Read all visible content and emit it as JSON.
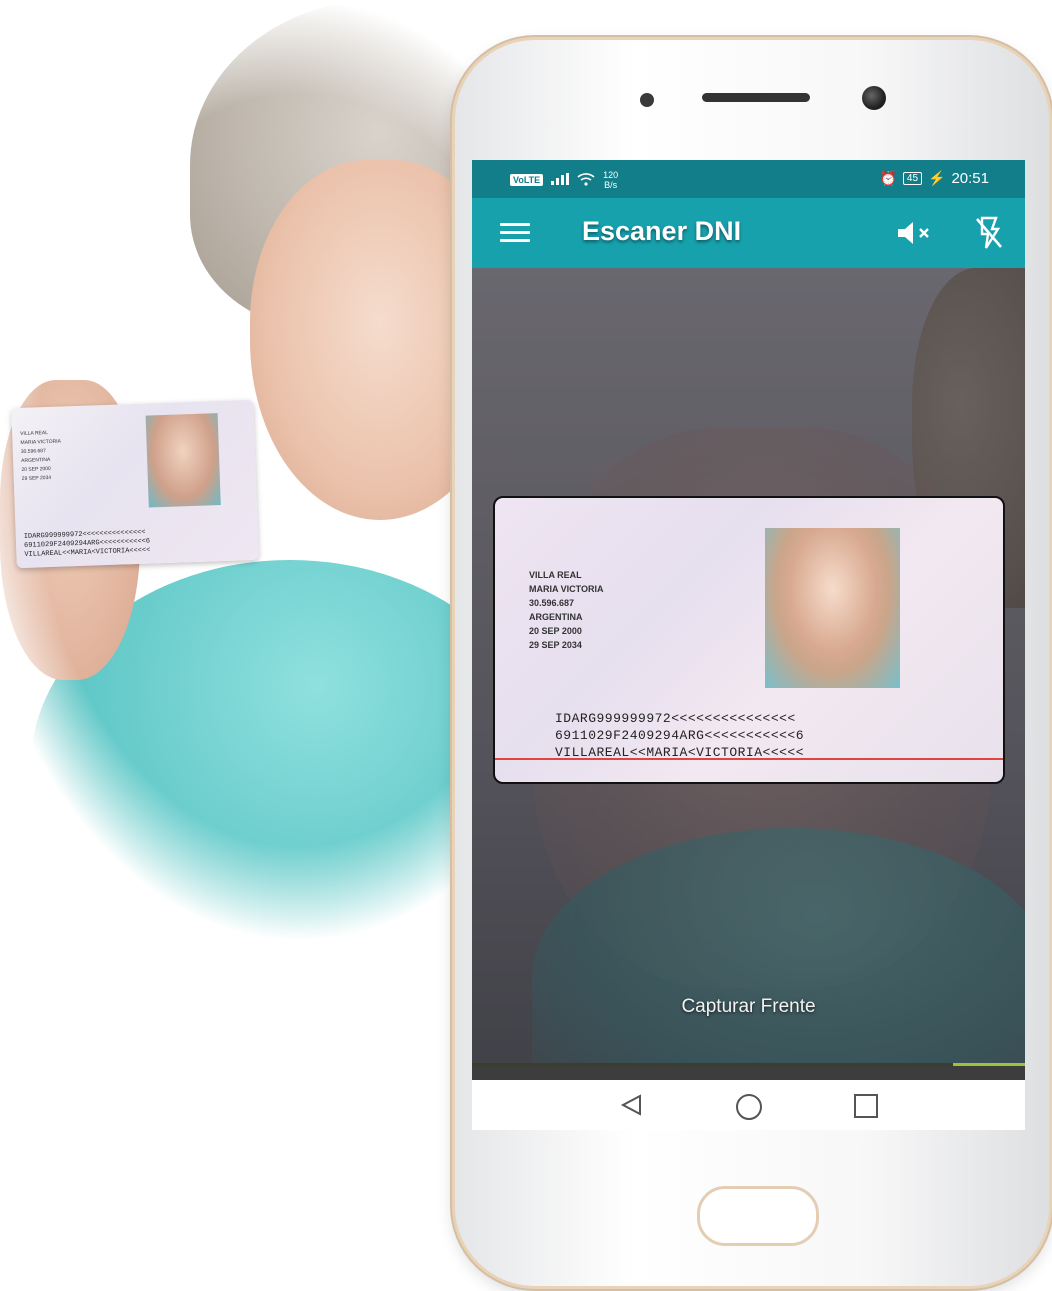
{
  "status_bar": {
    "network": "VoLTE",
    "speed_value": "120",
    "speed_unit": "B/s",
    "battery": "45",
    "time": "20:51"
  },
  "app_bar": {
    "title": "Escaner DNI",
    "icons": [
      "menu-icon",
      "mute-icon",
      "flash-off-icon"
    ]
  },
  "camera": {
    "capture_label": "Capturar Frente",
    "progress": 0.13
  },
  "id_card": {
    "fields": [
      "VILLA REAL",
      "MARIA VICTORIA",
      "30.596.687",
      "ARGENTINA",
      "20 SEP 2000",
      "29 SEP 2034"
    ],
    "mrz": [
      "IDARG999999972<<<<<<<<<<<<<<<",
      "6911029F2409294ARG<<<<<<<<<<<6",
      "VILLAREAL<<MARIA<VICTORIA<<<<<"
    ]
  },
  "nav_bar": {
    "icons": [
      "back-icon",
      "home-icon",
      "recent-apps-icon"
    ]
  },
  "colors": {
    "status_bar": "#127e8a",
    "app_bar": "#17a1ad",
    "scan_line": "#e0443f",
    "progress": "#9cc33b"
  }
}
